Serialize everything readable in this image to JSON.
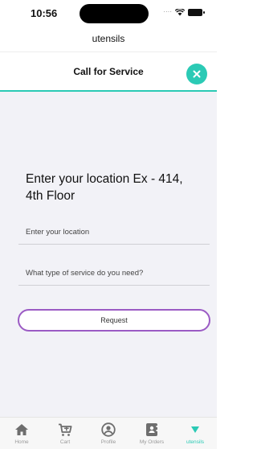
{
  "status_bar": {
    "time": "10:56"
  },
  "app": {
    "title": "utensils"
  },
  "header": {
    "title": "Call for Service"
  },
  "form": {
    "prompt": "Enter your location Ex - 414, 4th Floor",
    "location_placeholder": "Enter your location",
    "location_value": "",
    "service_placeholder": "What type of service do you need?",
    "service_value": "",
    "request_label": "Request"
  },
  "tab_bar": {
    "active": "utensils",
    "items": [
      {
        "label": "Home",
        "icon": "home-icon"
      },
      {
        "label": "Cart",
        "icon": "cart-icon"
      },
      {
        "label": "Profile",
        "icon": "profile-icon"
      },
      {
        "label": "My Orders",
        "icon": "orders-icon"
      },
      {
        "label": "utensils",
        "icon": "utensils-icon"
      }
    ]
  },
  "colors": {
    "accent": "#2bcab5",
    "button_border": "#9b5bc4",
    "content_bg": "#f2f2f7",
    "inactive_icon": "#6e6e6e"
  }
}
